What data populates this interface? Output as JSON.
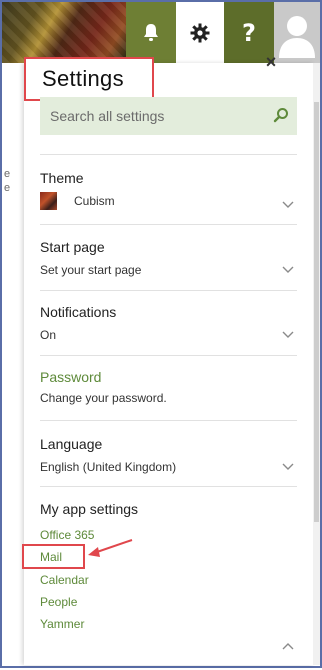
{
  "topbar": {
    "bell_icon": "bell-icon",
    "gear_icon": "gear-icon",
    "help_label": "?",
    "avatar_icon": "avatar-icon"
  },
  "edge_glyphs": [
    "e",
    "e"
  ],
  "settings": {
    "title": "Settings",
    "close_label": "×",
    "search_placeholder": "Search all settings",
    "theme": {
      "label": "Theme",
      "value": "Cubism"
    },
    "start_page": {
      "label": "Start page",
      "value": "Set your start page"
    },
    "notifications": {
      "label": "Notifications",
      "value": "On"
    },
    "password": {
      "label": "Password",
      "value": "Change your password."
    },
    "language": {
      "label": "Language",
      "value": "English (United Kingdom)"
    },
    "app_settings": {
      "label": "My app settings",
      "links": [
        "Office 365",
        "Mail",
        "Calendar",
        "People",
        "Yammer"
      ]
    }
  },
  "colors": {
    "accent_green": "#5e8a3a",
    "highlight_red": "#e0474c",
    "search_bg": "#e3eddc"
  }
}
